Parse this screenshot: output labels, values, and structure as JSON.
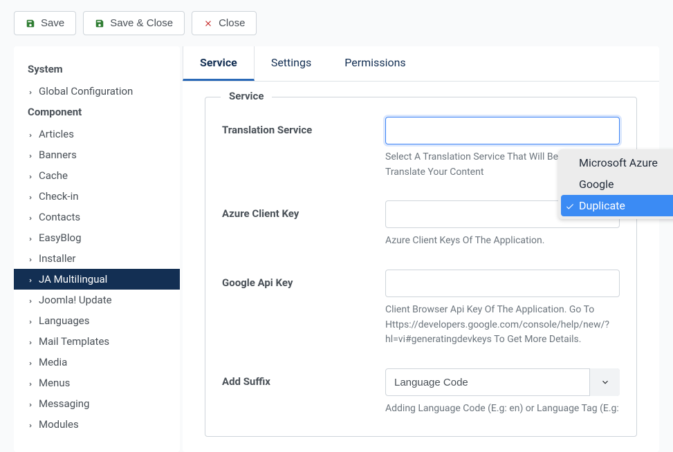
{
  "toolbar": {
    "save": "Save",
    "save_close": "Save & Close",
    "close": "Close"
  },
  "sidebar": {
    "system_heading": "System",
    "system_items": [
      {
        "label": "Global Configuration"
      }
    ],
    "component_heading": "Component",
    "component_items": [
      {
        "label": "Articles",
        "active": false
      },
      {
        "label": "Banners",
        "active": false
      },
      {
        "label": "Cache",
        "active": false
      },
      {
        "label": "Check-in",
        "active": false
      },
      {
        "label": "Contacts",
        "active": false
      },
      {
        "label": "EasyBlog",
        "active": false
      },
      {
        "label": "Installer",
        "active": false
      },
      {
        "label": "JA Multilingual",
        "active": true
      },
      {
        "label": "Joomla! Update",
        "active": false
      },
      {
        "label": "Languages",
        "active": false
      },
      {
        "label": "Mail Templates",
        "active": false
      },
      {
        "label": "Media",
        "active": false
      },
      {
        "label": "Menus",
        "active": false
      },
      {
        "label": "Messaging",
        "active": false
      },
      {
        "label": "Modules",
        "active": false
      }
    ]
  },
  "tabs": {
    "items": [
      {
        "label": "Service",
        "active": true
      },
      {
        "label": "Settings",
        "active": false
      },
      {
        "label": "Permissions",
        "active": false
      }
    ]
  },
  "fieldset": {
    "legend": "Service",
    "fields": {
      "service": {
        "label": "Translation Service",
        "help": "Select A Translation Service That Will Be Used To Translate Your Content",
        "options": [
          {
            "label": "Microsoft Azure",
            "selected": false
          },
          {
            "label": "Google",
            "selected": false
          },
          {
            "label": "Duplicate",
            "selected": true
          }
        ]
      },
      "azure_key": {
        "label": "Azure Client Key",
        "value": "",
        "help": "Azure Client Keys Of The Application."
      },
      "google_key": {
        "label": "Google Api Key",
        "value": "",
        "help": "Client Browser Api Key Of The Application. Go To Https://developers.google.com/console/help/new/?hl=vi#generatingdevkeys To Get More Details."
      },
      "suffix": {
        "label": "Add Suffix",
        "value": "Language Code",
        "help": "Adding Language Code (E.g: en) or Language Tag (E.g:"
      }
    }
  }
}
